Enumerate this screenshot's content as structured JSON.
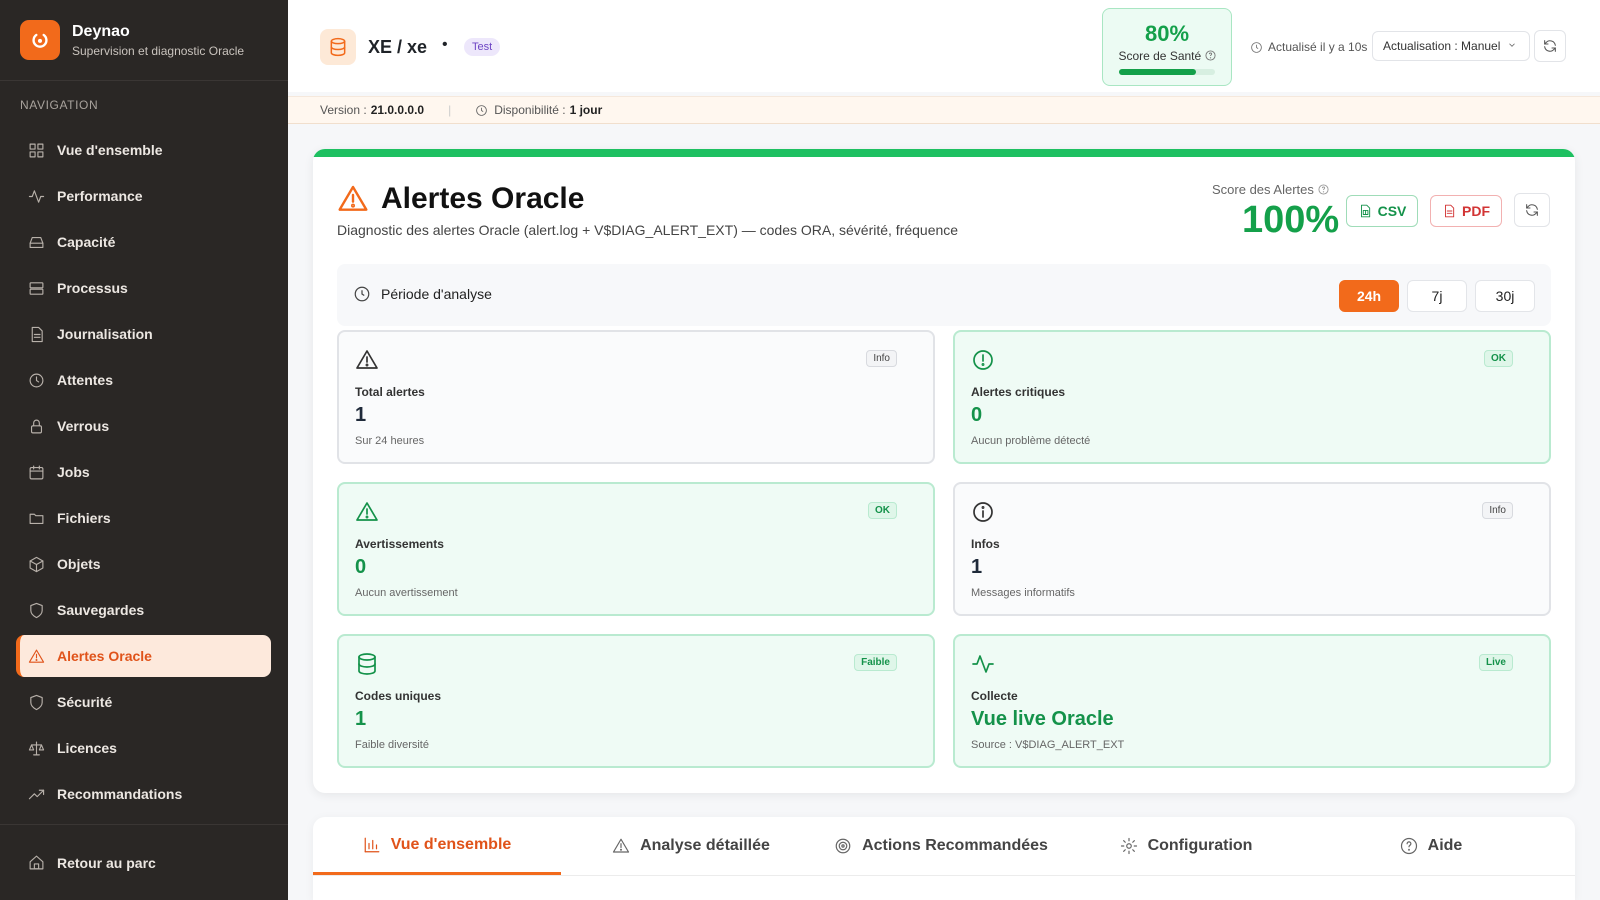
{
  "brand": {
    "name": "Deynao",
    "subtitle": "Supervision et diagnostic Oracle"
  },
  "sidebar": {
    "section_title": "NAVIGATION",
    "items": [
      {
        "label": "Vue d'ensemble",
        "icon": "grid-icon"
      },
      {
        "label": "Performance",
        "icon": "activity-icon"
      },
      {
        "label": "Capacité",
        "icon": "hard-drive-icon"
      },
      {
        "label": "Processus",
        "icon": "server-icon"
      },
      {
        "label": "Journalisation",
        "icon": "file-text-icon"
      },
      {
        "label": "Attentes",
        "icon": "clock-icon"
      },
      {
        "label": "Verrous",
        "icon": "lock-icon"
      },
      {
        "label": "Jobs",
        "icon": "calendar-icon"
      },
      {
        "label": "Fichiers",
        "icon": "folder-icon"
      },
      {
        "label": "Objets",
        "icon": "box-icon"
      },
      {
        "label": "Sauvegardes",
        "icon": "shield-icon"
      },
      {
        "label": "Alertes Oracle",
        "icon": "warning-icon",
        "active": true
      },
      {
        "label": "Sécurité",
        "icon": "shield-icon"
      },
      {
        "label": "Licences",
        "icon": "scale-icon"
      },
      {
        "label": "Recommandations",
        "icon": "trending-up-icon"
      }
    ],
    "back_label": "Retour au parc"
  },
  "header": {
    "db_name": "XE / xe",
    "separator": "•",
    "env_badge": "Test",
    "health": {
      "value": "80%",
      "label": "Score de Santé",
      "percent": 80
    },
    "updated": "Actualisé il y a 10s",
    "refresh_mode": "Actualisation : Manuel"
  },
  "infobar": {
    "version_label": "Version :",
    "version_value": "21.0.0.0.0",
    "availability_label": "Disponibilité :",
    "availability_value": "1 jour"
  },
  "main": {
    "title": "Alertes Oracle",
    "subtitle": "Diagnostic des alertes Oracle (alert.log + V$DIAG_ALERT_EXT) — codes ORA, sévérité, fréquence",
    "score_label": "Score des Alertes",
    "score_value": "100%",
    "csv_label": "CSV",
    "pdf_label": "PDF",
    "period": {
      "label": "Période d'analyse",
      "options": [
        "24h",
        "7j",
        "30j"
      ],
      "selected": "24h"
    },
    "stats": [
      {
        "label": "Total alertes",
        "value": "1",
        "note": "Sur 24 heures",
        "badge": "Info",
        "icon": "warning-icon",
        "green": false
      },
      {
        "label": "Alertes critiques",
        "value": "0",
        "note": "Aucun problème détecté",
        "badge": "OK",
        "icon": "alert-circle-icon",
        "green": true
      },
      {
        "label": "Avertissements",
        "value": "0",
        "note": "Aucun avertissement",
        "badge": "OK",
        "icon": "warning-icon",
        "green": true
      },
      {
        "label": "Infos",
        "value": "1",
        "note": "Messages informatifs",
        "badge": "Info",
        "icon": "info-icon",
        "green": false
      },
      {
        "label": "Codes uniques",
        "value": "1",
        "note": "Faible diversité",
        "badge": "Faible",
        "icon": "database-icon",
        "green": true
      },
      {
        "label": "Collecte",
        "value": "Vue live Oracle",
        "note": "Source : V$DIAG_ALERT_EXT",
        "badge": "Live",
        "icon": "activity-icon",
        "green": true
      }
    ]
  },
  "tabs": [
    {
      "label": "Vue d'ensemble",
      "icon": "bar-chart-icon",
      "active": true
    },
    {
      "label": "Analyse détaillée",
      "icon": "warning-icon"
    },
    {
      "label": "Actions Recommandées",
      "icon": "target-icon"
    },
    {
      "label": "Configuration",
      "icon": "gear-icon"
    },
    {
      "label": "Aide",
      "icon": "help-circle-icon"
    }
  ],
  "colors": {
    "accent": "#f26a1b",
    "success": "#14a04a",
    "sidebar_bg": "#2a2725",
    "danger": "#d23434"
  }
}
